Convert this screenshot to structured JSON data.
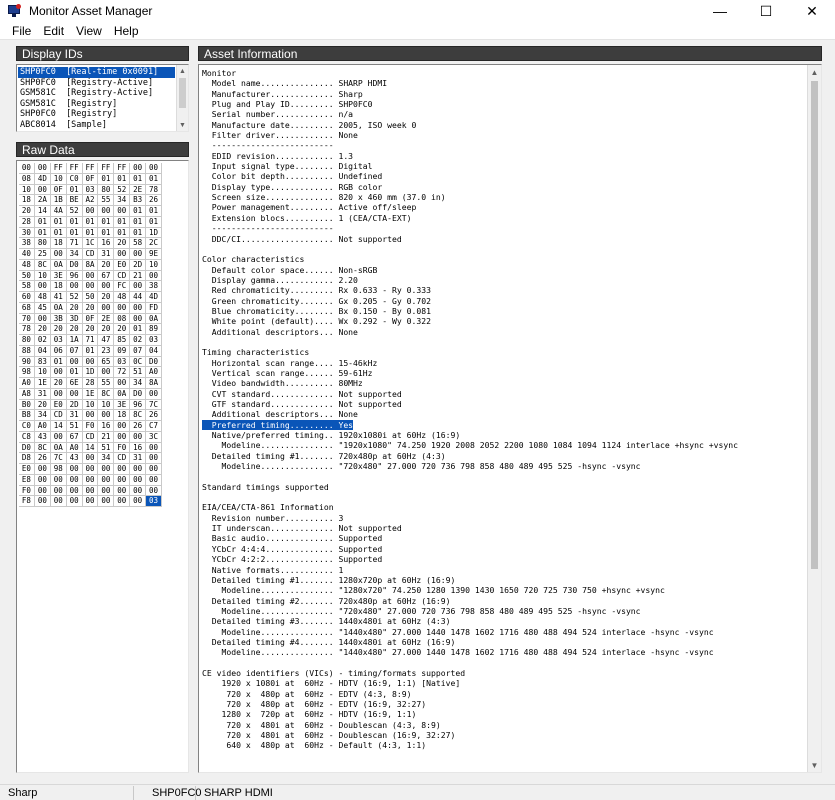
{
  "window": {
    "title": "Monitor Asset Manager",
    "minimize": "—",
    "maximize": "☐",
    "close": "✕"
  },
  "menu": [
    "File",
    "Edit",
    "View",
    "Help"
  ],
  "display_ids": {
    "header": "Display IDs",
    "items": [
      {
        "id": "SHP0FC0",
        "type": "[Real-time 0x0091]",
        "selected": true
      },
      {
        "id": "SHP0FC0",
        "type": "[Registry-Active]",
        "selected": false
      },
      {
        "id": "GSM581C",
        "type": "[Registry-Active]",
        "selected": false
      },
      {
        "id": "GSM581C",
        "type": "[Registry]",
        "selected": false
      },
      {
        "id": "SHP0FC0",
        "type": "[Registry]",
        "selected": false
      },
      {
        "id": "ABC8014",
        "type": "[Sample]",
        "selected": false
      }
    ]
  },
  "raw_data": {
    "header": "Raw Data",
    "rows": [
      [
        "00",
        "00",
        "FF",
        "FF",
        "FF",
        "FF",
        "FF",
        "00"
      ],
      [
        "08",
        "4D",
        "10",
        "C0",
        "0F",
        "01",
        "01",
        "01"
      ],
      [
        "10",
        "00",
        "0F",
        "01",
        "03",
        "80",
        "52",
        "2E"
      ],
      [
        "18",
        "2A",
        "1B",
        "BE",
        "A2",
        "55",
        "34",
        "B3"
      ],
      [
        "20",
        "14",
        "4A",
        "52",
        "00",
        "00",
        "00",
        "01"
      ],
      [
        "28",
        "01",
        "01",
        "01",
        "01",
        "01",
        "01",
        "01"
      ],
      [
        "30",
        "01",
        "01",
        "01",
        "01",
        "01",
        "01",
        "01"
      ],
      [
        "38",
        "80",
        "18",
        "71",
        "1C",
        "16",
        "20",
        "58"
      ],
      [
        "40",
        "25",
        "00",
        "34",
        "CD",
        "31",
        "00",
        "00"
      ],
      [
        "48",
        "8C",
        "0A",
        "D0",
        "8A",
        "20",
        "E0",
        "2D"
      ],
      [
        "50",
        "10",
        "3E",
        "96",
        "00",
        "67",
        "CD",
        "21"
      ],
      [
        "58",
        "00",
        "18",
        "00",
        "00",
        "00",
        "FC",
        "00"
      ],
      [
        "60",
        "48",
        "41",
        "52",
        "50",
        "20",
        "48",
        "44"
      ],
      [
        "68",
        "45",
        "0A",
        "20",
        "20",
        "00",
        "00",
        "00"
      ],
      [
        "70",
        "00",
        "3B",
        "3D",
        "0F",
        "2E",
        "08",
        "00"
      ],
      [
        "78",
        "20",
        "20",
        "20",
        "20",
        "20",
        "20",
        "01"
      ],
      [
        "80",
        "02",
        "03",
        "1A",
        "71",
        "47",
        "85",
        "02"
      ],
      [
        "88",
        "04",
        "06",
        "07",
        "01",
        "23",
        "09",
        "07"
      ],
      [
        "90",
        "83",
        "01",
        "00",
        "00",
        "65",
        "03",
        "0C"
      ],
      [
        "98",
        "10",
        "00",
        "01",
        "1D",
        "00",
        "72",
        "51"
      ],
      [
        "A0",
        "1E",
        "20",
        "6E",
        "28",
        "55",
        "00",
        "34"
      ],
      [
        "A8",
        "31",
        "00",
        "00",
        "1E",
        "8C",
        "0A",
        "D0"
      ],
      [
        "B0",
        "20",
        "E0",
        "2D",
        "10",
        "10",
        "3E",
        "96"
      ],
      [
        "B8",
        "34",
        "CD",
        "31",
        "00",
        "00",
        "18",
        "8C"
      ],
      [
        "C0",
        "A0",
        "14",
        "51",
        "F0",
        "16",
        "00",
        "26"
      ],
      [
        "C8",
        "43",
        "00",
        "67",
        "CD",
        "21",
        "00",
        "00"
      ],
      [
        "D0",
        "8C",
        "0A",
        "A0",
        "14",
        "51",
        "F0",
        "16"
      ],
      [
        "D8",
        "26",
        "7C",
        "43",
        "00",
        "34",
        "CD",
        "31"
      ],
      [
        "E0",
        "00",
        "98",
        "00",
        "00",
        "00",
        "00",
        "00"
      ],
      [
        "E8",
        "00",
        "00",
        "00",
        "00",
        "00",
        "00",
        "00"
      ],
      [
        "F0",
        "00",
        "00",
        "00",
        "00",
        "00",
        "00",
        "00"
      ],
      [
        "F8",
        "00",
        "00",
        "00",
        "00",
        "00",
        "00",
        "00"
      ]
    ],
    "extra_col": [
      "00",
      "01",
      "78",
      "26",
      "01",
      "01",
      "1D",
      "2C",
      "9E",
      "10",
      "00",
      "38",
      "4D",
      "FD",
      "0A",
      "89",
      "03",
      "04",
      "D0",
      "A0",
      "8A",
      "00",
      "7C",
      "26",
      "C7",
      "3C",
      "00",
      "00",
      "00",
      "00",
      "00",
      "03"
    ],
    "selected_row": 31
  },
  "asset_info": {
    "header": "Asset Information",
    "highlight_line": 34,
    "lines": [
      "Monitor",
      "  Model name............... SHARP HDMI",
      "  Manufacturer............. Sharp",
      "  Plug and Play ID......... SHP0FC0",
      "  Serial number............ n/a",
      "  Manufacture date......... 2005, ISO week 0",
      "  Filter driver............ None",
      "  -------------------------",
      "  EDID revision............ 1.3",
      "  Input signal type........ Digital",
      "  Color bit depth.......... Undefined",
      "  Display type............. RGB color",
      "  Screen size.............. 820 x 460 mm (37.0 in)",
      "  Power management......... Active off/sleep",
      "  Extension blocs.......... 1 (CEA/CTA-EXT)",
      "  -------------------------",
      "  DDC/CI................... Not supported",
      "",
      "Color characteristics",
      "  Default color space...... Non-sRGB",
      "  Display gamma............ 2.20",
      "  Red chromaticity......... Rx 0.633 - Ry 0.333",
      "  Green chromaticity....... Gx 0.205 - Gy 0.702",
      "  Blue chromaticity........ Bx 0.150 - By 0.081",
      "  White point (default).... Wx 0.292 - Wy 0.322",
      "  Additional descriptors... None",
      "",
      "Timing characteristics",
      "  Horizontal scan range.... 15-46kHz",
      "  Vertical scan range...... 59-61Hz",
      "  Video bandwidth.......... 80MHz",
      "  CVT standard............. Not supported",
      "  GTF standard............. Not supported",
      "  Additional descriptors... None",
      "  Preferred timing......... Yes",
      "  Native/preferred timing.. 1920x1080i at 60Hz (16:9)",
      "    Modeline............... \"1920x1080\" 74.250 1920 2008 2052 2200 1080 1084 1094 1124 interlace +hsync +vsync",
      "  Detailed timing #1....... 720x480p at 60Hz (4:3)",
      "    Modeline............... \"720x480\" 27.000 720 736 798 858 480 489 495 525 -hsync -vsync",
      "",
      "Standard timings supported",
      "",
      "EIA/CEA/CTA-861 Information",
      "  Revision number.......... 3",
      "  IT underscan............. Not supported",
      "  Basic audio.............. Supported",
      "  YCbCr 4:4:4.............. Supported",
      "  YCbCr 4:2:2.............. Supported",
      "  Native formats........... 1",
      "  Detailed timing #1....... 1280x720p at 60Hz (16:9)",
      "    Modeline............... \"1280x720\" 74.250 1280 1390 1430 1650 720 725 730 750 +hsync +vsync",
      "  Detailed timing #2....... 720x480p at 60Hz (16:9)",
      "    Modeline............... \"720x480\" 27.000 720 736 798 858 480 489 495 525 -hsync -vsync",
      "  Detailed timing #3....... 1440x480i at 60Hz (4:3)",
      "    Modeline............... \"1440x480\" 27.000 1440 1478 1602 1716 480 488 494 524 interlace -hsync -vsync",
      "  Detailed timing #4....... 1440x480i at 60Hz (16:9)",
      "    Modeline............... \"1440x480\" 27.000 1440 1478 1602 1716 480 488 494 524 interlace -hsync -vsync",
      "",
      "CE video identifiers (VICs) - timing/formats supported",
      "    1920 x 1080i at  60Hz - HDTV (16:9, 1:1) [Native]",
      "     720 x  480p at  60Hz - EDTV (4:3, 8:9)",
      "     720 x  480p at  60Hz - EDTV (16:9, 32:27)",
      "    1280 x  720p at  60Hz - HDTV (16:9, 1:1)",
      "     720 x  480i at  60Hz - Doublescan (4:3, 8:9)",
      "     720 x  480i at  60Hz - Doublescan (16:9, 32:27)",
      "     640 x  480p at  60Hz - Default (4:3, 1:1)"
    ]
  },
  "status": {
    "manufacturer": "Sharp",
    "pnp_id": "SHP0FC0",
    "model": "SHARP HDMI"
  }
}
